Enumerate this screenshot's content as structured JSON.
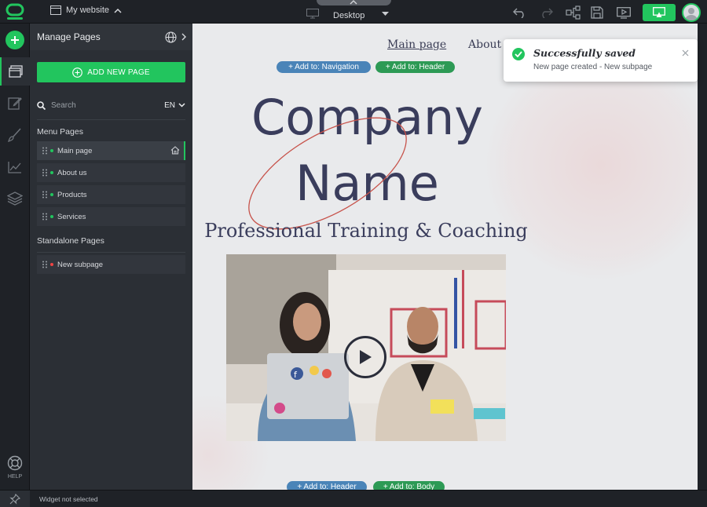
{
  "topbar": {
    "site_name": "My website",
    "device_label": "Desktop"
  },
  "rail": {
    "help_label": "HELP"
  },
  "panel": {
    "title": "Manage Pages",
    "add_page_label": "ADD NEW PAGE",
    "search_placeholder": "Search",
    "language": "EN",
    "menu_section_label": "Menu Pages",
    "menu_pages": [
      {
        "label": "Main page",
        "status": "green",
        "selected": true,
        "home": true
      },
      {
        "label": "About us",
        "status": "green"
      },
      {
        "label": "Products",
        "status": "green"
      },
      {
        "label": "Services",
        "status": "green"
      }
    ],
    "standalone_section_label": "Standalone Pages",
    "standalone_pages": [
      {
        "label": "New subpage",
        "status": "red"
      }
    ]
  },
  "canvas": {
    "nav_main": "Main page",
    "nav_about": "About u",
    "add_navigation": "+ Add to: Navigation",
    "add_header_top": "+ Add to: Header",
    "company_line1": "Company",
    "company_line2": "Name",
    "tagline": "Professional Training & Coaching",
    "laptop_sticker": "f",
    "add_header_bottom": "+ Add to: Header",
    "add_body": "+ Add to: Body"
  },
  "toast": {
    "title": "Successfully saved",
    "message": "New page created - New subpage"
  },
  "statusbar": {
    "text": "Widget not selected"
  },
  "colors": {
    "accent": "#22c55e",
    "panel": "#2b2f35",
    "chrome": "#1f2227",
    "status_red": "#ef4444",
    "heading": "#3a3d5c"
  }
}
